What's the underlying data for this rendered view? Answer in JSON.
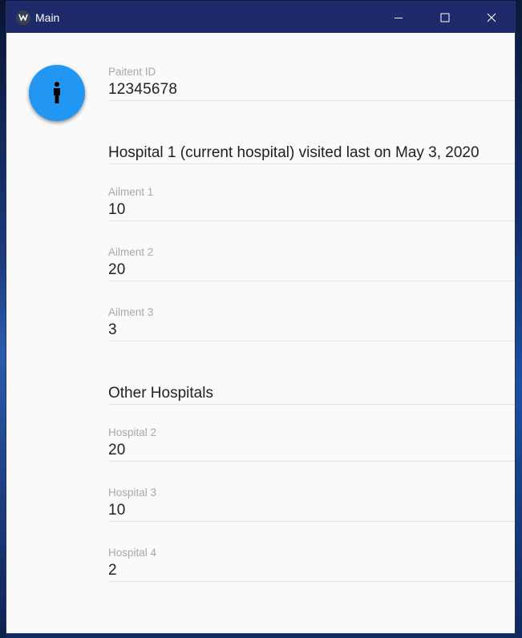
{
  "window": {
    "title": "Main",
    "controls": {
      "minimize": "minimize-icon",
      "maximize": "maximize-icon",
      "close": "close-icon"
    }
  },
  "avatar": {
    "icon": "person-icon",
    "color": "#2196f3"
  },
  "patient": {
    "label": "Paitent ID",
    "value": "12345678"
  },
  "current_hospital": {
    "heading": "Hospital 1 (current hospital) visited last on May 3, 2020",
    "ailments": [
      {
        "label": "Ailment 1",
        "value": "10"
      },
      {
        "label": "Ailment 2",
        "value": "20"
      },
      {
        "label": "Ailment 3",
        "value": "3"
      }
    ]
  },
  "other_hospitals": {
    "heading": "Other Hospitals",
    "items": [
      {
        "label": "Hospital 2",
        "value": "20"
      },
      {
        "label": "Hospital 3",
        "value": "10"
      },
      {
        "label": "Hospital 4",
        "value": "2"
      }
    ]
  },
  "colors": {
    "titlebar": "#1f2a6b",
    "accent": "#2196f3",
    "background": "#fafafa"
  }
}
